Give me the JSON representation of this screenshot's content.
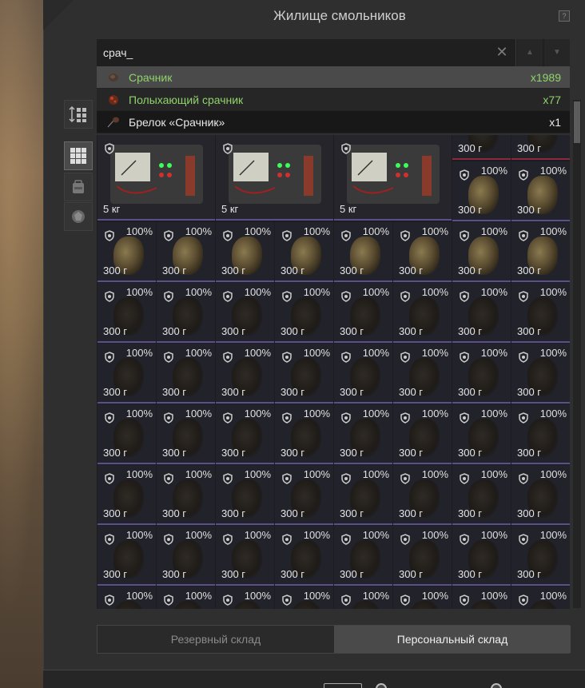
{
  "window": {
    "title": "Жилище смольников",
    "help_label": "?"
  },
  "search": {
    "value": "срач_",
    "clear_icon": "close-icon",
    "up_icon": "arrow-up-icon",
    "down_icon": "arrow-down-icon"
  },
  "suggestions": [
    {
      "label": "Срачник",
      "count": "x1989",
      "color": "#8fd36a",
      "icon": "ore-icon"
    },
    {
      "label": "Полыхающий срачник",
      "count": "x77",
      "color": "#8fd36a",
      "icon": "burning-ore-icon"
    },
    {
      "label": "Брелок «Срачник»",
      "count": "x1",
      "color": "#e8e8e8",
      "icon": "keychain-icon"
    }
  ],
  "toolbar": {
    "sort_icon": "sort-grid-icon",
    "grid_icon": "grid-view-icon",
    "backpack_icon": "backpack-icon",
    "resource_icon": "resource-icon"
  },
  "grid": {
    "boxes": [
      {
        "weight": "5 кг"
      },
      {
        "weight": "5 кг"
      },
      {
        "weight": "5 кг"
      }
    ],
    "top_row_partial": [
      {
        "weight": "300 г"
      },
      {
        "weight": "300 г"
      }
    ],
    "second_row_right": [
      {
        "percent": "100%",
        "weight": "300 г"
      },
      {
        "percent": "100%",
        "weight": "300 г"
      }
    ],
    "lit_row": {
      "percent": "100%",
      "weight": "300 г"
    },
    "dark_rows": {
      "percent": "100%",
      "weight": "300 г"
    },
    "last_row": {
      "percent": "100%"
    }
  },
  "tabs": {
    "reserve": "Резервный склад",
    "personal": "Персональный склад"
  },
  "colors": {
    "accent_green": "#8fd36a",
    "cell_border": "#5a4f8a",
    "panel_bg": "#2f2f2f"
  }
}
